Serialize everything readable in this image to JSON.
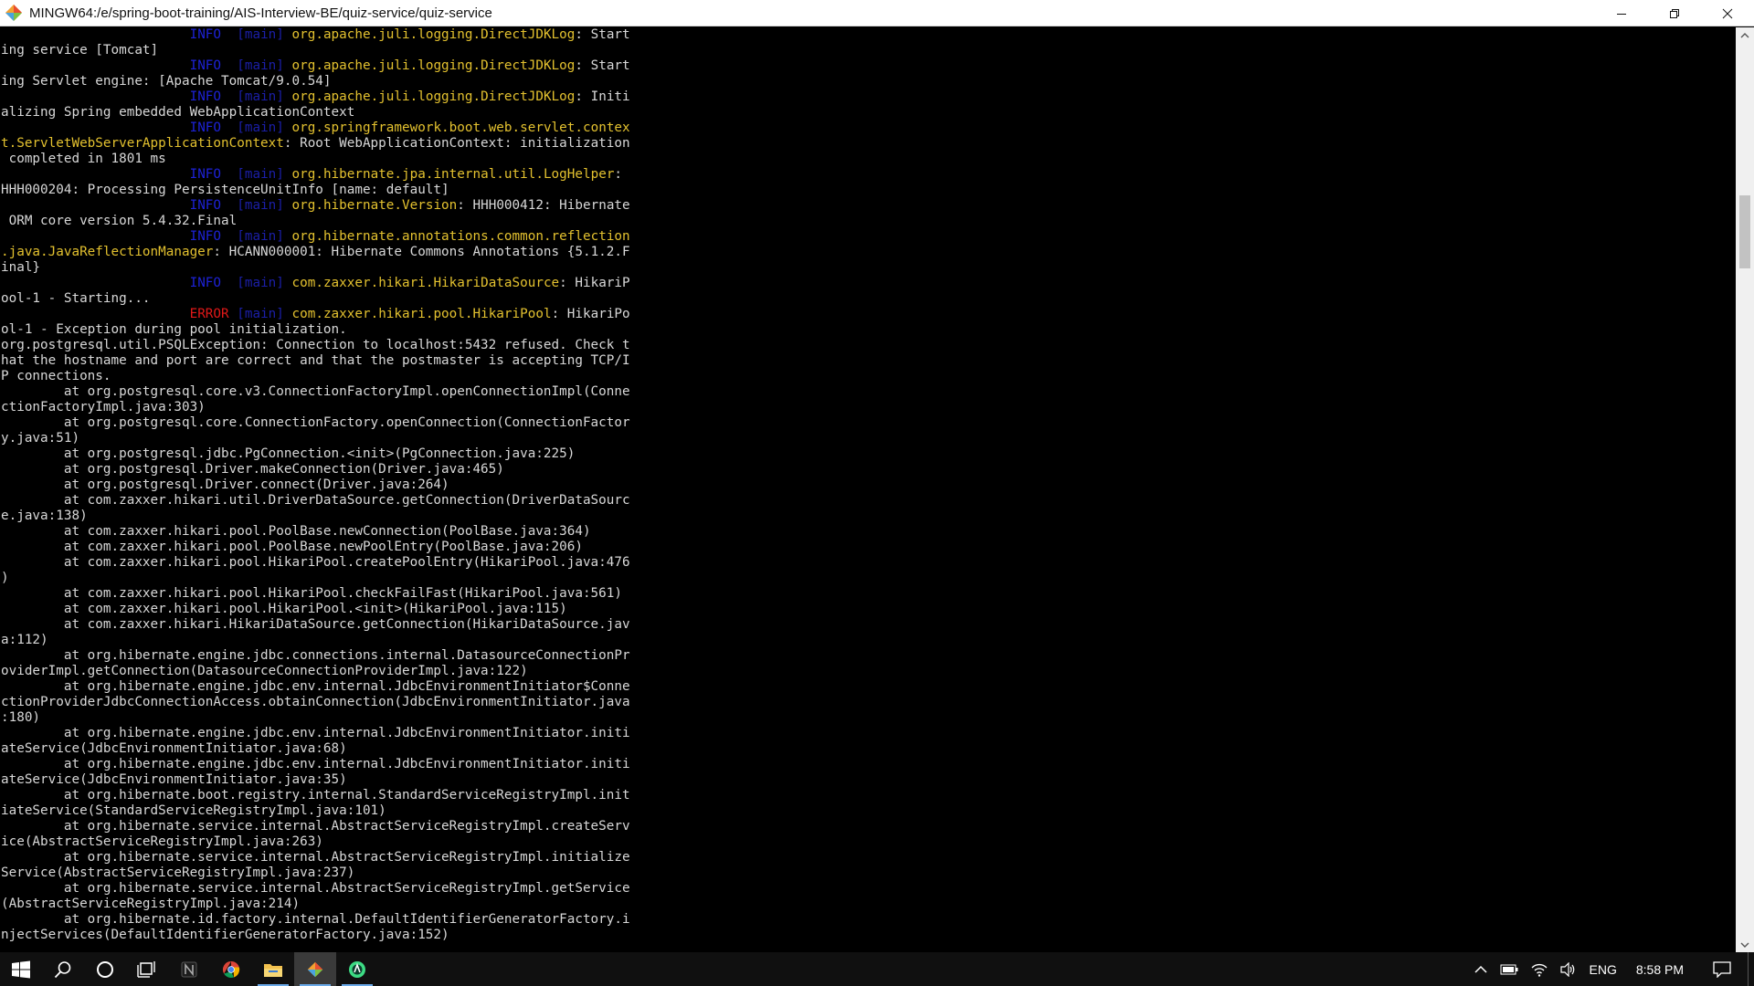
{
  "window": {
    "title": "MINGW64:/e/spring-boot-training/AIS-Interview-BE/quiz-service/quiz-service"
  },
  "colors": {
    "info": "#1d22d6",
    "error": "#e01818",
    "thread": "#1b1fa8",
    "logger": "#e3c12f",
    "text": "#d8d8d8",
    "background": "#000000"
  },
  "terminal": {
    "lines": [
      {
        "pad": "                        ",
        "level": "INFO ",
        "thread": "[main]",
        "logger": "org.apache.juli.logging.DirectJDKLog",
        "rest": ": Start"
      },
      {
        "text": "ing service [Tomcat]"
      },
      {
        "pad": "                        ",
        "level": "INFO ",
        "thread": "[main]",
        "logger": "org.apache.juli.logging.DirectJDKLog",
        "rest": ": Start"
      },
      {
        "text": "ing Servlet engine: [Apache Tomcat/9.0.54]"
      },
      {
        "pad": "                        ",
        "level": "INFO ",
        "thread": "[main]",
        "logger": "org.apache.juli.logging.DirectJDKLog",
        "rest": ": Initi"
      },
      {
        "text": "alizing Spring embedded WebApplicationContext"
      },
      {
        "pad": "                        ",
        "level": "INFO ",
        "thread": "[main]",
        "logger": "org.springframework.boot.web.servlet.contex",
        "rest": ""
      },
      {
        "logger": "t.ServletWebServerApplicationContext",
        "rest": ": Root WebApplicationContext: initialization"
      },
      {
        "text": " completed in 1801 ms"
      },
      {
        "pad": "                        ",
        "level": "INFO ",
        "thread": "[main]",
        "logger": "org.hibernate.jpa.internal.util.LogHelper",
        "rest": ":"
      },
      {
        "text": "HHH000204: Processing PersistenceUnitInfo [name: default]"
      },
      {
        "pad": "                        ",
        "level": "INFO ",
        "thread": "[main]",
        "logger": "org.hibernate.Version",
        "rest": ": HHH000412: Hibernate"
      },
      {
        "text": " ORM core version 5.4.32.Final"
      },
      {
        "pad": "                        ",
        "level": "INFO ",
        "thread": "[main]",
        "logger": "org.hibernate.annotations.common.reflection",
        "rest": ""
      },
      {
        "logger": ".java.JavaReflectionManager",
        "rest": ": HCANN000001: Hibernate Commons Annotations {5.1.2.F"
      },
      {
        "text": "inal}"
      },
      {
        "pad": "                        ",
        "level": "INFO ",
        "thread": "[main]",
        "logger": "com.zaxxer.hikari.HikariDataSource",
        "rest": ": HikariP"
      },
      {
        "text": "ool-1 - Starting..."
      },
      {
        "pad": "                        ",
        "level": "ERROR",
        "thread": "[main]",
        "logger": "com.zaxxer.hikari.pool.HikariPool",
        "rest": ": HikariPo"
      },
      {
        "text": "ol-1 - Exception during pool initialization."
      },
      {
        "text": "org.postgresql.util.PSQLException: Connection to localhost:5432 refused. Check t"
      },
      {
        "text": "hat the hostname and port are correct and that the postmaster is accepting TCP/I"
      },
      {
        "text": "P connections."
      },
      {
        "text": "        at org.postgresql.core.v3.ConnectionFactoryImpl.openConnectionImpl(Conne"
      },
      {
        "text": "ctionFactoryImpl.java:303)"
      },
      {
        "text": "        at org.postgresql.core.ConnectionFactory.openConnection(ConnectionFactor"
      },
      {
        "text": "y.java:51)"
      },
      {
        "text": "        at org.postgresql.jdbc.PgConnection.<init>(PgConnection.java:225)"
      },
      {
        "text": "        at org.postgresql.Driver.makeConnection(Driver.java:465)"
      },
      {
        "text": "        at org.postgresql.Driver.connect(Driver.java:264)"
      },
      {
        "text": "        at com.zaxxer.hikari.util.DriverDataSource.getConnection(DriverDataSourc"
      },
      {
        "text": "e.java:138)"
      },
      {
        "text": "        at com.zaxxer.hikari.pool.PoolBase.newConnection(PoolBase.java:364)"
      },
      {
        "text": "        at com.zaxxer.hikari.pool.PoolBase.newPoolEntry(PoolBase.java:206)"
      },
      {
        "text": "        at com.zaxxer.hikari.pool.HikariPool.createPoolEntry(HikariPool.java:476"
      },
      {
        "text": ")"
      },
      {
        "text": "        at com.zaxxer.hikari.pool.HikariPool.checkFailFast(HikariPool.java:561)"
      },
      {
        "text": "        at com.zaxxer.hikari.pool.HikariPool.<init>(HikariPool.java:115)"
      },
      {
        "text": "        at com.zaxxer.hikari.HikariDataSource.getConnection(HikariDataSource.jav"
      },
      {
        "text": "a:112)"
      },
      {
        "text": "        at org.hibernate.engine.jdbc.connections.internal.DatasourceConnectionPr"
      },
      {
        "text": "oviderImpl.getConnection(DatasourceConnectionProviderImpl.java:122)"
      },
      {
        "text": "        at org.hibernate.engine.jdbc.env.internal.JdbcEnvironmentInitiator$Conne"
      },
      {
        "text": "ctionProviderJdbcConnectionAccess.obtainConnection(JdbcEnvironmentInitiator.java"
      },
      {
        "text": ":180)"
      },
      {
        "text": "        at org.hibernate.engine.jdbc.env.internal.JdbcEnvironmentInitiator.initi"
      },
      {
        "text": "ateService(JdbcEnvironmentInitiator.java:68)"
      },
      {
        "text": "        at org.hibernate.engine.jdbc.env.internal.JdbcEnvironmentInitiator.initi"
      },
      {
        "text": "ateService(JdbcEnvironmentInitiator.java:35)"
      },
      {
        "text": "        at org.hibernate.boot.registry.internal.StandardServiceRegistryImpl.init"
      },
      {
        "text": "iateService(StandardServiceRegistryImpl.java:101)"
      },
      {
        "text": "        at org.hibernate.service.internal.AbstractServiceRegistryImpl.createServ"
      },
      {
        "text": "ice(AbstractServiceRegistryImpl.java:263)"
      },
      {
        "text": "        at org.hibernate.service.internal.AbstractServiceRegistryImpl.initialize"
      },
      {
        "text": "Service(AbstractServiceRegistryImpl.java:237)"
      },
      {
        "text": "        at org.hibernate.service.internal.AbstractServiceRegistryImpl.getService"
      },
      {
        "text": "(AbstractServiceRegistryImpl.java:214)"
      },
      {
        "text": "        at org.hibernate.id.factory.internal.DefaultIdentifierGeneratorFactory.i"
      },
      {
        "text": "njectServices(DefaultIdentifierGeneratorFactory.java:152)"
      }
    ]
  },
  "taskbar": {
    "icons": [
      "windows-start-icon",
      "search-icon",
      "cortana-icon",
      "task-view-icon",
      "notion-icon",
      "chrome-icon",
      "file-explorer-icon",
      "git-bash-icon",
      "android-studio-icon"
    ],
    "tray": {
      "language": "ENG",
      "time": "8:58 PM"
    }
  }
}
